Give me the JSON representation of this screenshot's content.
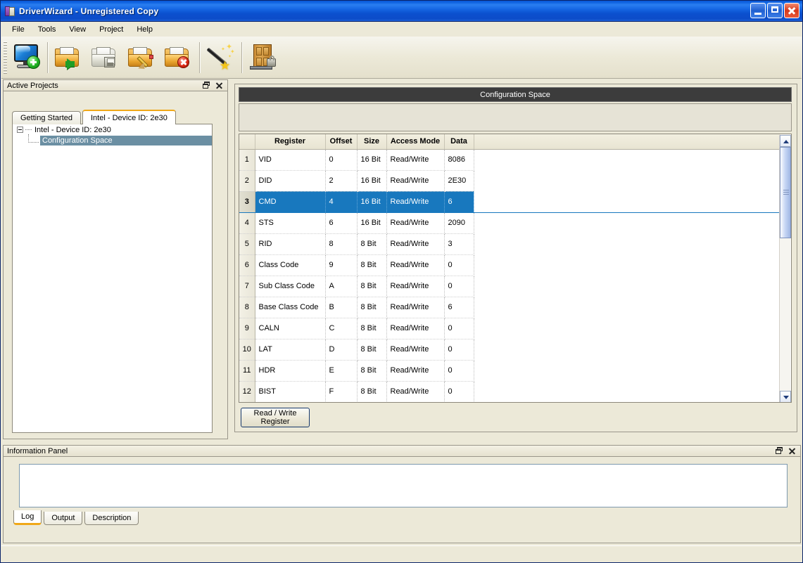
{
  "window": {
    "title": "DriverWizard - Unregistered Copy",
    "icon": "driverwizard-app-icon",
    "controls": {
      "minimize": "minimize-icon",
      "maximize": "maximize-icon",
      "close": "close-icon"
    }
  },
  "menu": {
    "items": [
      "File",
      "Tools",
      "View",
      "Project",
      "Help"
    ]
  },
  "toolbar": {
    "buttons": [
      {
        "name": "new-project",
        "icon": "monitor-with-plus-icon"
      },
      {
        "name": "open-project",
        "icon": "folder-with-green-arrow-icon"
      },
      {
        "name": "save-project",
        "icon": "gray-folder-with-disk-icon"
      },
      {
        "name": "edit-project",
        "icon": "folder-with-pencil-icon"
      },
      {
        "name": "delete-project",
        "icon": "folder-with-red-x-icon"
      },
      {
        "name": "wizard",
        "icon": "magic-wand-icon"
      },
      {
        "name": "driver-access",
        "icon": "door-with-lock-icon"
      }
    ]
  },
  "left_panel": {
    "caption": "Active Projects",
    "caption_buttons": {
      "restore": "restore-icon",
      "close": "close-icon"
    },
    "tabs": [
      {
        "label": "Getting Started",
        "active": false
      },
      {
        "label": "Intel - Device ID: 2e30",
        "active": true
      }
    ],
    "tree": {
      "root": {
        "label": "Intel - Device ID: 2e30",
        "expanded": true
      },
      "children": [
        {
          "label": "Configuration Space",
          "selected": true
        }
      ]
    }
  },
  "main_panel": {
    "header_title": "Configuration Space",
    "grid": {
      "columns": [
        "",
        "Register",
        "Offset",
        "Size",
        "Access Mode",
        "Data"
      ],
      "rows": [
        {
          "n": "1",
          "register": "VID",
          "offset": "0",
          "size": "16 Bit",
          "access": "Read/Write",
          "data": "8086",
          "selected": false
        },
        {
          "n": "2",
          "register": "DID",
          "offset": "2",
          "size": "16 Bit",
          "access": "Read/Write",
          "data": "2E30",
          "selected": false
        },
        {
          "n": "3",
          "register": "CMD",
          "offset": "4",
          "size": "16 Bit",
          "access": "Read/Write",
          "data": "6",
          "selected": true
        },
        {
          "n": "4",
          "register": "STS",
          "offset": "6",
          "size": "16 Bit",
          "access": "Read/Write",
          "data": "2090",
          "selected": false
        },
        {
          "n": "5",
          "register": "RID",
          "offset": "8",
          "size": "8 Bit",
          "access": "Read/Write",
          "data": "3",
          "selected": false
        },
        {
          "n": "6",
          "register": "Class Code",
          "offset": "9",
          "size": "8 Bit",
          "access": "Read/Write",
          "data": "0",
          "selected": false
        },
        {
          "n": "7",
          "register": "Sub Class Code",
          "offset": "A",
          "size": "8 Bit",
          "access": "Read/Write",
          "data": "0",
          "selected": false
        },
        {
          "n": "8",
          "register": "Base Class Code",
          "offset": "B",
          "size": "8 Bit",
          "access": "Read/Write",
          "data": "6",
          "selected": false
        },
        {
          "n": "9",
          "register": "CALN",
          "offset": "C",
          "size": "8 Bit",
          "access": "Read/Write",
          "data": "0",
          "selected": false
        },
        {
          "n": "10",
          "register": "LAT",
          "offset": "D",
          "size": "8 Bit",
          "access": "Read/Write",
          "data": "0",
          "selected": false
        },
        {
          "n": "11",
          "register": "HDR",
          "offset": "E",
          "size": "8 Bit",
          "access": "Read/Write",
          "data": "0",
          "selected": false
        },
        {
          "n": "12",
          "register": "BIST",
          "offset": "F",
          "size": "8 Bit",
          "access": "Read/Write",
          "data": "0",
          "selected": false
        }
      ]
    },
    "scrollbar": {
      "up": "scroll-up-arrow-icon",
      "down": "scroll-down-arrow-icon"
    },
    "read_write_button": {
      "line1": "Read / Write",
      "line2": "Register"
    }
  },
  "info_panel": {
    "caption": "Information Panel",
    "caption_buttons": {
      "restore": "restore-icon",
      "close": "close-icon"
    },
    "log_text": "",
    "tabs": [
      {
        "label": "Log",
        "active": true
      },
      {
        "label": "Output",
        "active": false
      },
      {
        "label": "Description",
        "active": false
      }
    ]
  },
  "statusbar": {
    "text": ""
  },
  "colors": {
    "titlebar_blue": "#0f62e0",
    "selection_blue": "#1878be",
    "tree_selection": "#6b8fa3",
    "tab_accent_orange": "#f0a818",
    "header_dark": "#3c3c3c",
    "window_bg": "#ece9d8"
  }
}
